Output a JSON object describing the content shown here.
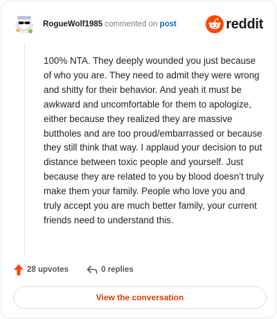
{
  "comment": {
    "username": "RogueWolf1985",
    "verb": "commented on",
    "target": "post",
    "body": "100% NTA. They deeply wounded you just because of who you are. They need to admit they were wrong and shitty for their behavior. And yeah it must be awkward and uncomfortable for them to apologize, either because they realized they are massive buttholes and are too proud/embarrassed or because they still think that way. I applaud your decision to put distance between toxic people and yourself. Just because they are related to you by blood doesn’t truly make them your family. People who love you and truly accept you are much better family, your current friends need to understand this."
  },
  "brand": {
    "wordmark": "reddit",
    "icon": "reddit-snoo-icon",
    "color": "#ff4500"
  },
  "actions": {
    "upvotes_label": "28 upvotes",
    "replies_label": "0 replies"
  },
  "cta": {
    "label": "View the conversation"
  },
  "colors": {
    "accent": "#d93900",
    "upvote": "#ff4500",
    "link": "#0a66c2"
  }
}
